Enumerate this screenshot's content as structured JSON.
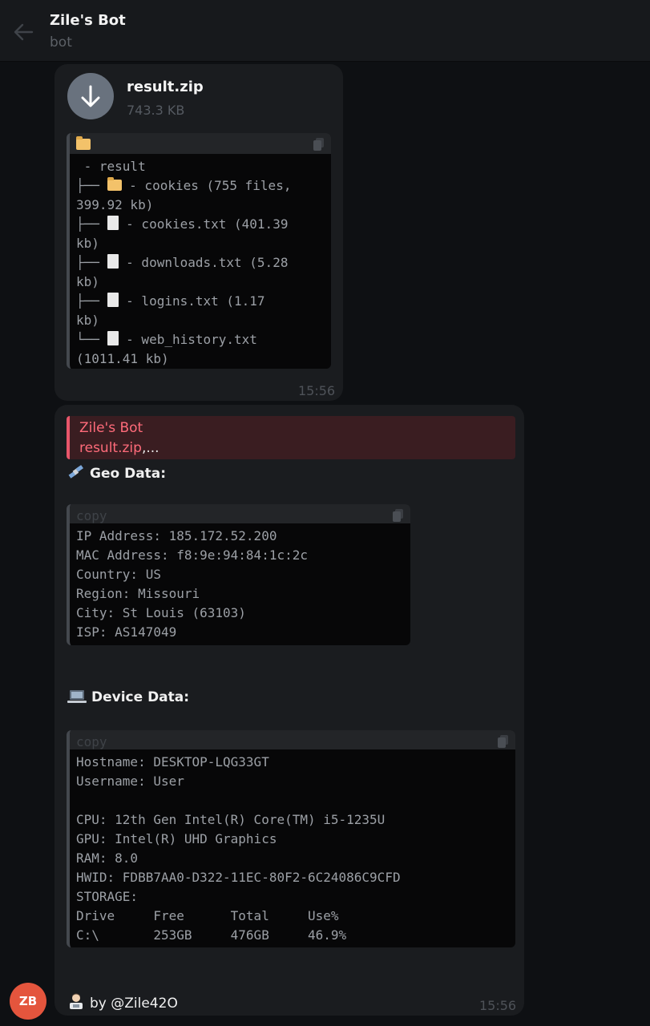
{
  "header": {
    "title": "Zile's Bot",
    "subtitle": "bot"
  },
  "message1": {
    "file_name": "result.zip",
    "file_size": "743.3 KB",
    "tree_lines": [
      " - result",
      "├── ",
      "399.92 kb)",
      "├── ",
      "kb)",
      "├── ",
      "kb)",
      "├── ",
      "kb)",
      "└── ",
      "(1011.41 kb)"
    ],
    "tree_items": [
      " - cookies (755 files,",
      " - cookies.txt (401.39",
      " - downloads.txt (5.28",
      " - logins.txt (1.17",
      " - web_history.txt"
    ],
    "time": "15:56"
  },
  "message2": {
    "reply_name": "Zile's Bot",
    "reply_text_link": "result.zip",
    "reply_text_rest": ",...",
    "geo_title": "Geo Data:",
    "geo_copy": "copy",
    "geo_lines": [
      "IP Address: 185.172.52.200",
      "MAC Address: f8:9e:94:84:1c:2c",
      "Country: US",
      "Region: Missouri",
      "City: St Louis (63103)",
      "ISP: AS147049"
    ],
    "device_title": "Device Data:",
    "device_copy": "copy",
    "device_lines": [
      "Hostname: DESKTOP-LQG33GT",
      "Username: User",
      "",
      "CPU: 12th Gen Intel(R) Core(TM) i5-1235U",
      "GPU: Intel(R) UHD Graphics",
      "RAM: 8.0",
      "HWID: FDBB7AA0-D322-11EC-80F2-6C24086C9CFD",
      "STORAGE:",
      "Drive     Free      Total     Use%",
      "C:\\       253GB     476GB     46.9%"
    ],
    "footer_text": "by @Zile42O",
    "time": "15:56"
  },
  "avatar": {
    "initials": "ZB",
    "color": "#e4553d"
  },
  "colors": {
    "background": "#0e1013",
    "bubble": "#1a1c1f",
    "reply_accent": "#e8566a"
  }
}
